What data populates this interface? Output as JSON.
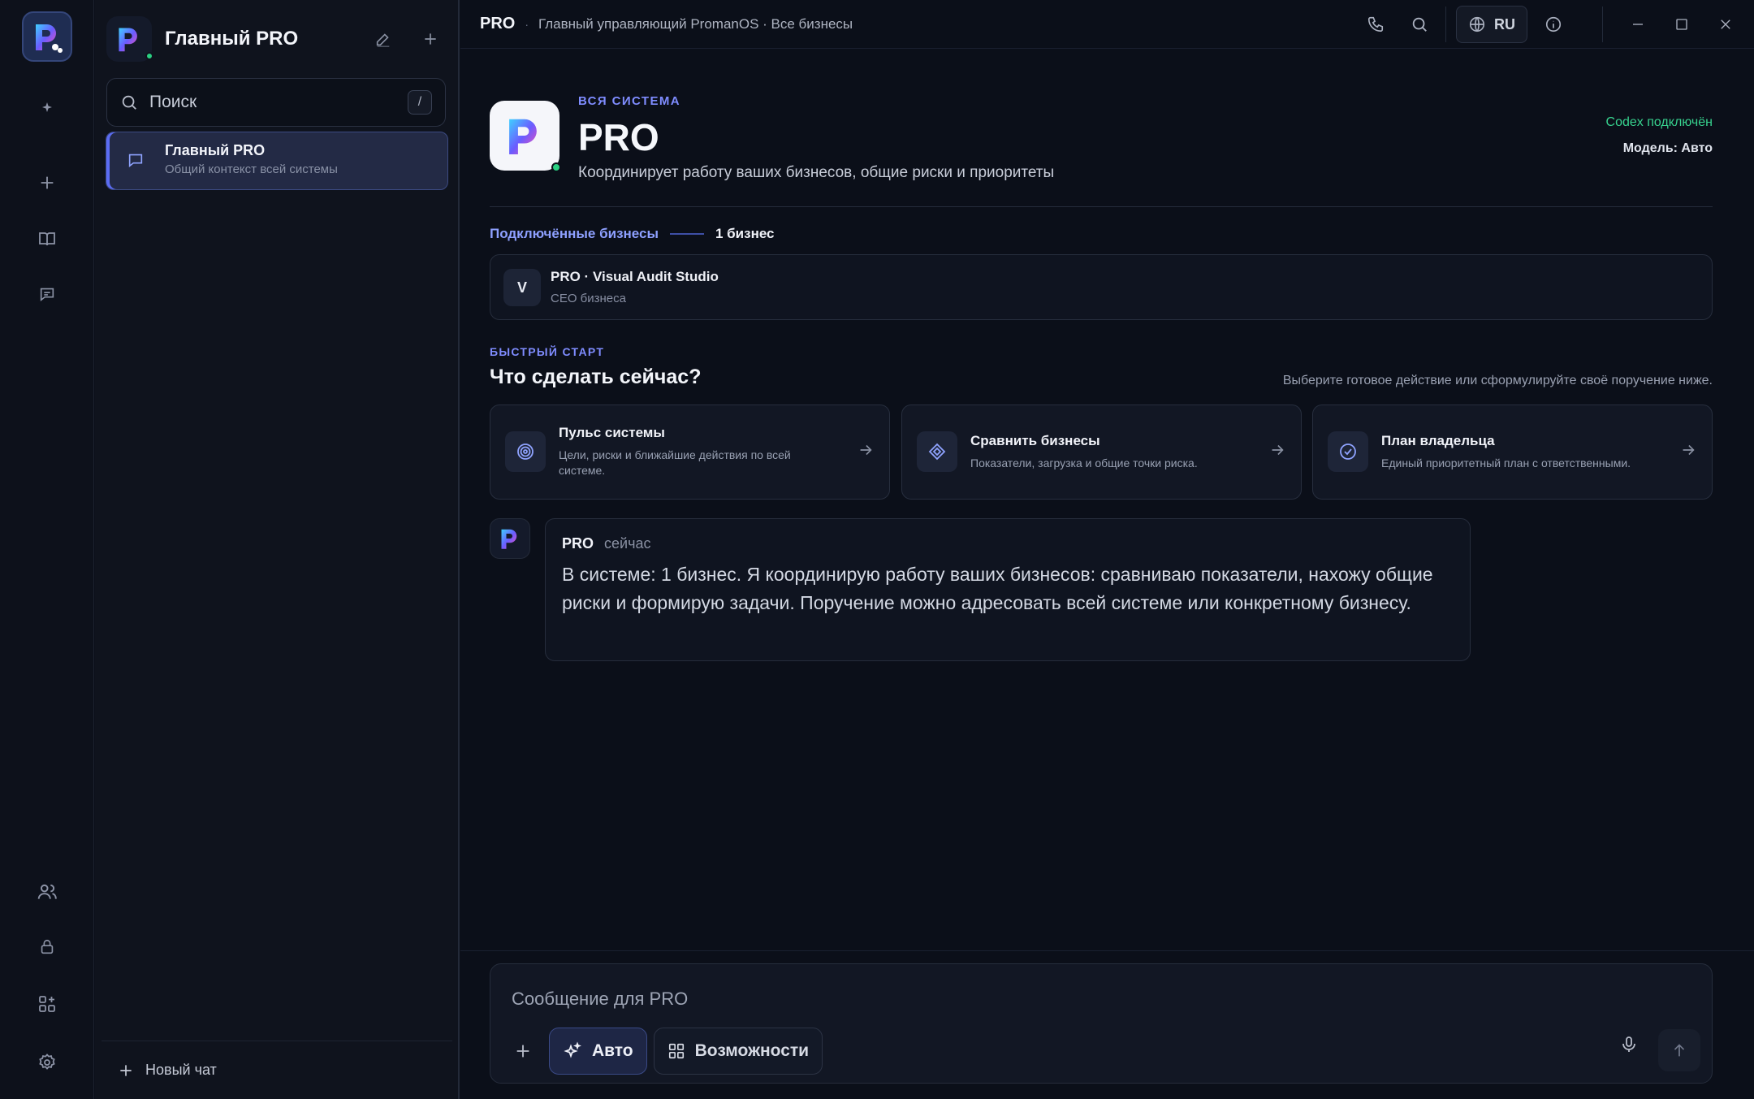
{
  "sidebar": {
    "title": "Главный PRO",
    "search_placeholder": "Поиск",
    "search_shortcut": "/",
    "chats": [
      {
        "title": "Главный PRO",
        "subtitle": "Общий контекст всей системы"
      }
    ],
    "new_chat": "Новый чат"
  },
  "topbar": {
    "brand": "PRO",
    "separator": "·",
    "subtitle": "Главный управляющий PromanOS · Все бизнесы",
    "language": "RU"
  },
  "hero": {
    "kicker": "ВСЯ СИСТЕМА",
    "title": "PRO",
    "description": "Координирует работу ваших бизнесов, общие риски и приоритеты",
    "status": "Codex подключён",
    "model": "Модель: Авто"
  },
  "connected": {
    "label": "Подключённые бизнесы",
    "count": "1 бизнес",
    "items": [
      {
        "avatar": "V",
        "name": "PRO · Visual Audit Studio",
        "role": "CEO бизнеса"
      }
    ]
  },
  "quickstart": {
    "kicker": "БЫСТРЫЙ СТАРТ",
    "title": "Что сделать сейчас?",
    "hint": "Выберите готовое действие или сформулируйте своё поручение ниже.",
    "cards": [
      {
        "title": "Пульс системы",
        "desc": "Цели, риски и ближайшие действия по всей системе.",
        "icon": "target-icon"
      },
      {
        "title": "Сравнить бизнесы",
        "desc": "Показатели, загрузка и общие точки риска.",
        "icon": "diamond-icon"
      },
      {
        "title": "План владельца",
        "desc": "Единый приоритетный план с ответственными.",
        "icon": "check-circle-icon"
      }
    ]
  },
  "message": {
    "author": "PRO",
    "time": "сейчас",
    "text": "В системе: 1 бизнес. Я координирую работу ваших бизнесов: сравниваю показатели, нахожу общие риски и формирую задачи. Поручение можно адресовать всей системе или конкретному бизнесу."
  },
  "composer": {
    "placeholder": "Сообщение для PRO",
    "auto_label": "Авто",
    "capabilities_label": "Возможности"
  },
  "colors": {
    "accent": "#7f8cff",
    "status_ok": "#37d28e",
    "background": "#0b0f19"
  }
}
